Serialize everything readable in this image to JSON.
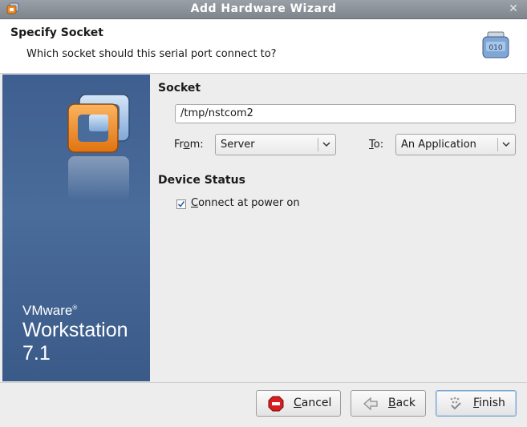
{
  "window": {
    "title": "Add Hardware Wizard"
  },
  "header": {
    "title": "Specify Socket",
    "subtitle": "Which socket should this serial port connect to?",
    "icon": "serial-port-icon",
    "icon_text": "010"
  },
  "sidebar": {
    "brand_line1": "VMware",
    "brand_mark": "®",
    "brand_line2": "Workstation 7.1"
  },
  "socket": {
    "section_label": "Socket",
    "path": "/tmp/nstcom2",
    "from_label_pre": "Fr",
    "from_label_u": "o",
    "from_label_post": "m:",
    "from_value": "Server",
    "to_label_u": "T",
    "to_label_post": "o:",
    "to_value": "An Application"
  },
  "device_status": {
    "section_label": "Device Status",
    "connect_checked": true,
    "connect_label_u": "C",
    "connect_label_rest": "onnect at power on"
  },
  "buttons": {
    "cancel_u": "C",
    "cancel_rest": "ancel",
    "back_u": "B",
    "back_rest": "ack",
    "finish_u": "F",
    "finish_rest": "inish"
  },
  "colors": {
    "sidebar_blue": "#4a6c9b",
    "accent_orange": "#f08a24",
    "default_button_border": "#7aa3cc"
  }
}
